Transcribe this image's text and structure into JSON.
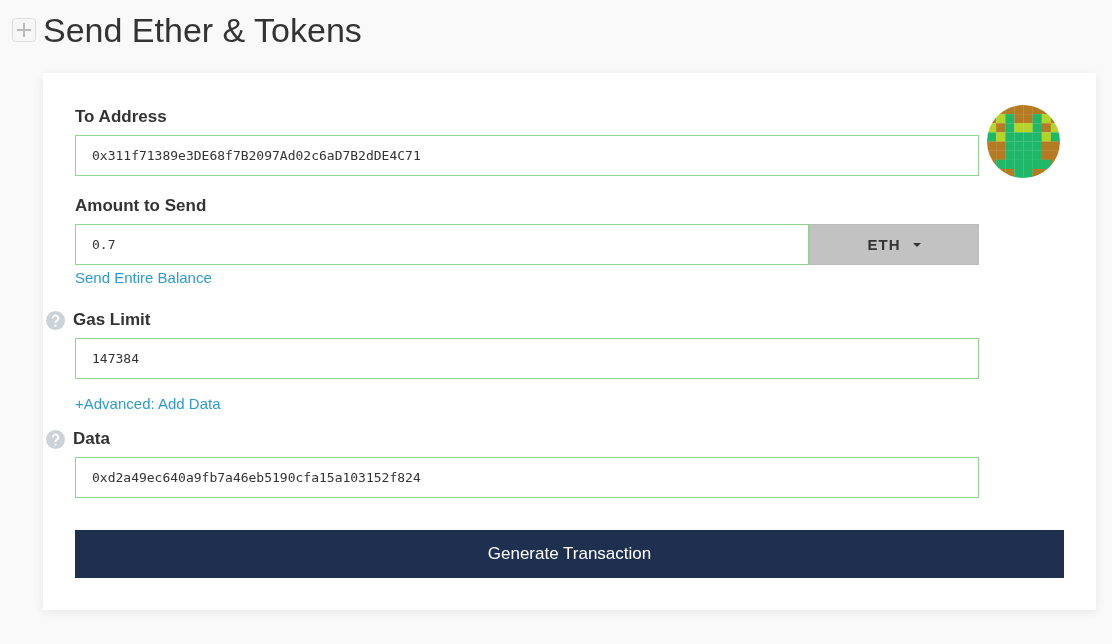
{
  "title": "Send Ether & Tokens",
  "fields": [
    {
      "kind": "address",
      "label": "To Address",
      "value": "0x311f71389e3DE68f7B2097Ad02c6aD7B2dDE4C71",
      "valid": true
    },
    {
      "kind": "amount",
      "label": "Amount to Send",
      "value": "0.7",
      "valid": true,
      "unit": "ETH",
      "link": "Send Entire Balance"
    },
    {
      "kind": "plain",
      "label": "Gas Limit",
      "value": "147384",
      "valid": true,
      "link": "+Advanced: Add Data"
    },
    {
      "kind": "plain",
      "label": "Data",
      "value": "0xd2a49ec640a9fb7a46eb5190cfa15a103152f824",
      "valid": true
    }
  ],
  "button": "Generate Transaction"
}
